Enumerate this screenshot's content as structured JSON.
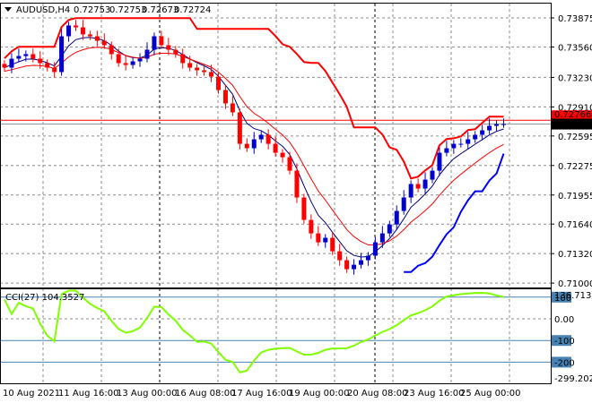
{
  "header": {
    "symbol": "AUDUSD,H4",
    "open": "0.72753",
    "high": "0.72753",
    "low": "0.72673",
    "close": "0.72724"
  },
  "indicator": {
    "label": "CCI(27) 104.3527",
    "max_label": "136.713",
    "min_label": "-299.2023"
  },
  "colors": {
    "bull": "#0000cc",
    "bear": "#ff0000",
    "ma_fast": "#000080",
    "ma_slow": "#ff0000",
    "cci": "#80ff00",
    "level": "#4682b4"
  },
  "chart_data": {
    "type": "candlestick",
    "title": "AUDUSD,H4",
    "price_ticks": [
      "0.73875",
      "0.73560",
      "0.73230",
      "0.72910",
      "0.72595",
      "0.72275",
      "0.71955",
      "0.71640",
      "0.71320",
      "0.71000"
    ],
    "price_tick_values": [
      0.73875,
      0.7356,
      0.7323,
      0.7291,
      0.72595,
      0.72275,
      0.71955,
      0.7164,
      0.7132,
      0.71
    ],
    "ylim": [
      0.71,
      0.7403
    ],
    "ask_line": "0.72766",
    "bid_label": "0.72724",
    "bid_value": 0.72724,
    "ask_value": 0.72766,
    "x_labels": [
      "10 Aug 2021",
      "11 Aug 16:00",
      "13 Aug 00:00",
      "16 Aug 08:00",
      "17 Aug 16:00",
      "19 Aug 00:00",
      "20 Aug 08:00",
      "23 Aug 16:00",
      "25 Aug 00:00"
    ],
    "closes": [
      0.73336,
      0.73433,
      0.73462,
      0.73482,
      0.73433,
      0.73385,
      0.73336,
      0.73288,
      0.73676,
      0.73793,
      0.73773,
      0.73696,
      0.73676,
      0.73627,
      0.73579,
      0.73482,
      0.73385,
      0.73365,
      0.73404,
      0.73433,
      0.7353,
      0.73676,
      0.73579,
      0.7353,
      0.73482,
      0.73385,
      0.73336,
      0.73307,
      0.73288,
      0.73239,
      0.73093,
      0.72948,
      0.72851,
      0.7251,
      0.72462,
      0.72559,
      0.72608,
      0.7251,
      0.72413,
      0.72365,
      0.72219,
      0.71928,
      0.71685,
      0.71539,
      0.71442,
      0.71491,
      0.71345,
      0.71248,
      0.71151,
      0.71199,
      0.71248,
      0.71297,
      0.71442,
      0.71539,
      0.71636,
      0.71782,
      0.71928,
      0.72074,
      0.72025,
      0.72122,
      0.72219,
      0.72413,
      0.72462,
      0.7251,
      0.7251,
      0.72559,
      0.72608,
      0.72656,
      0.72705,
      0.72724,
      0.72724
    ],
    "cci_levels": [
      100,
      0,
      -100,
      -200
    ],
    "cci_ticks": [
      "100",
      "0.00",
      "-100",
      "-200"
    ],
    "cci_range": [
      -299.2023,
      136.713
    ]
  }
}
